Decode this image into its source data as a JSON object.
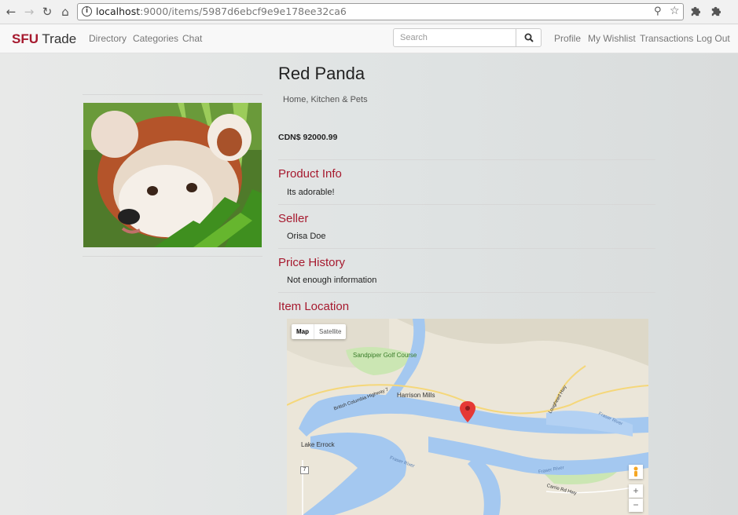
{
  "browser": {
    "url_host": "localhost",
    "url_rest": ":9000/items/5987d6ebcf9e9e178ee32ca6"
  },
  "navbar": {
    "brand_prefix": "SFU",
    "brand_suffix": " Trade",
    "links": [
      "Directory",
      "Categories",
      "Chat"
    ],
    "search_placeholder": "Search",
    "right_links": [
      "Profile",
      "My Wishlist",
      "Transactions",
      "Log Out"
    ]
  },
  "item": {
    "title": "Red Panda",
    "category": "Home, Kitchen & Pets",
    "price": "CDN$ 92000.99",
    "sections": [
      {
        "heading": "Product Info",
        "text": "Its adorable!"
      },
      {
        "heading": "Seller",
        "text": "Orisa Doe"
      },
      {
        "heading": "Price History",
        "text": "Not enough information"
      },
      {
        "heading": "Item Location"
      }
    ]
  },
  "map": {
    "type_options": [
      "Map",
      "Satellite"
    ],
    "selected_type": "Map",
    "labels": [
      "Sandpiper Golf Course",
      "Harrison Mills",
      "Lake Errock",
      "British Columbia Highway 7",
      "Lougheed Hwy",
      "Fraser River",
      "Fraser River",
      "Fraser River",
      "Carrie Rd Hwy"
    ],
    "route_markers": [
      "7"
    ],
    "zoom_in": "+",
    "zoom_out": "−"
  },
  "colors": {
    "brand": "#a6192e",
    "water": "#a4c8f0",
    "land": "#ebe6d9",
    "park": "#cbe6b3",
    "marker": "#e53935"
  }
}
